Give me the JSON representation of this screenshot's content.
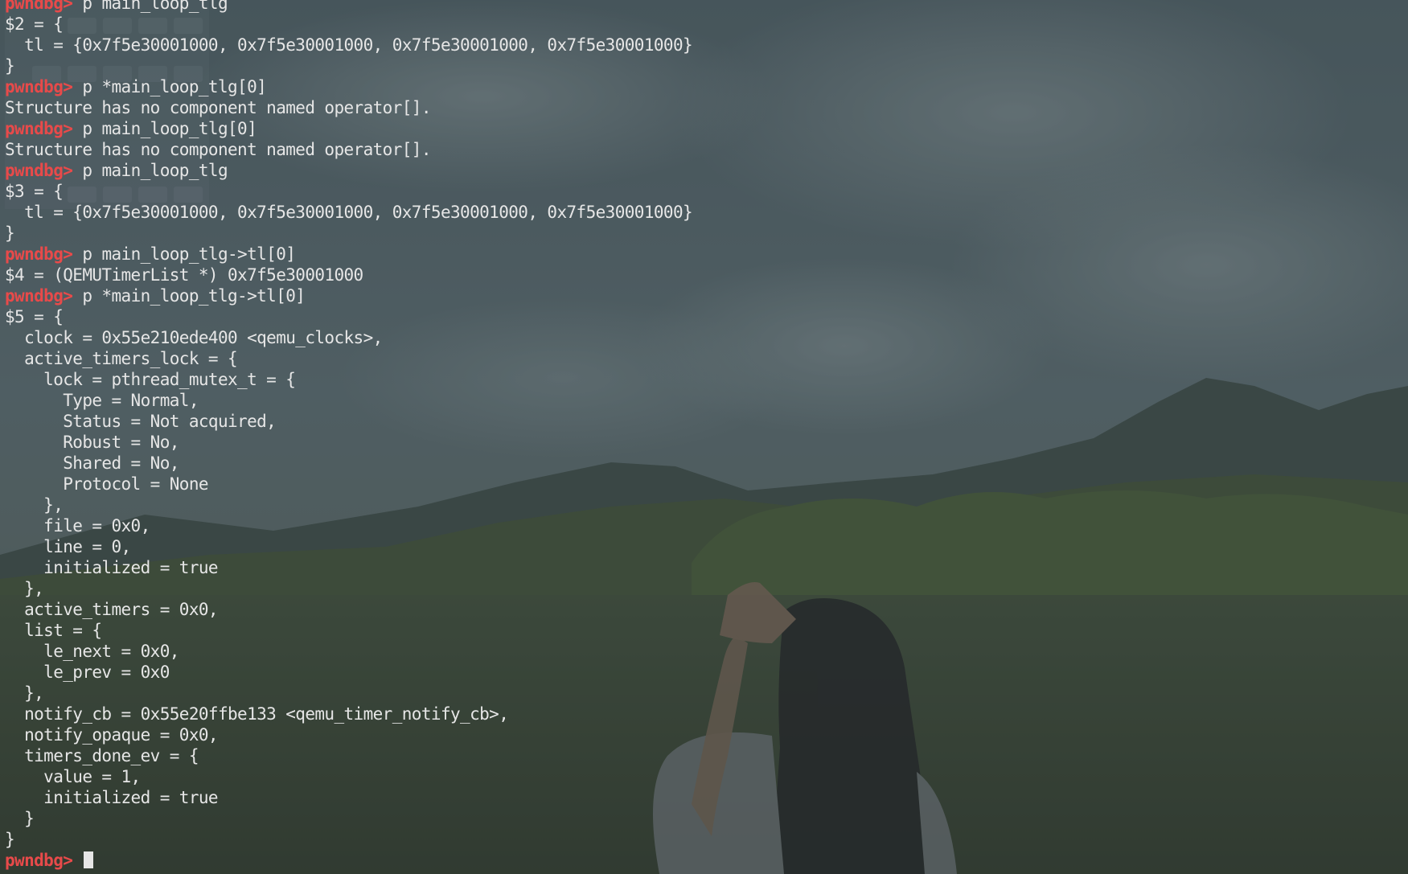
{
  "terminal": {
    "prompt": "pwndbg>",
    "lines": [
      {
        "type": "cmd",
        "text": "p main_loop_tlg"
      },
      {
        "type": "out",
        "text": "$2 = {"
      },
      {
        "type": "out",
        "text": "  tl = {0x7f5e30001000, 0x7f5e30001000, 0x7f5e30001000, 0x7f5e30001000}"
      },
      {
        "type": "out",
        "text": "}"
      },
      {
        "type": "cmd",
        "text": "p *main_loop_tlg[0]"
      },
      {
        "type": "out",
        "text": "Structure has no component named operator[]."
      },
      {
        "type": "cmd",
        "text": "p main_loop_tlg[0]"
      },
      {
        "type": "out",
        "text": "Structure has no component named operator[]."
      },
      {
        "type": "cmd",
        "text": "p main_loop_tlg"
      },
      {
        "type": "out",
        "text": "$3 = {"
      },
      {
        "type": "out",
        "text": "  tl = {0x7f5e30001000, 0x7f5e30001000, 0x7f5e30001000, 0x7f5e30001000}"
      },
      {
        "type": "out",
        "text": "}"
      },
      {
        "type": "cmd",
        "text": "p main_loop_tlg->tl[0]"
      },
      {
        "type": "out",
        "text": "$4 = (QEMUTimerList *) 0x7f5e30001000"
      },
      {
        "type": "cmd",
        "text": "p *main_loop_tlg->tl[0]"
      },
      {
        "type": "out",
        "text": "$5 = {"
      },
      {
        "type": "out",
        "text": "  clock = 0x55e210ede400 <qemu_clocks>,"
      },
      {
        "type": "out",
        "text": "  active_timers_lock = {"
      },
      {
        "type": "out",
        "text": "    lock = pthread_mutex_t = {"
      },
      {
        "type": "out",
        "text": "      Type = Normal,"
      },
      {
        "type": "out",
        "text": "      Status = Not acquired,"
      },
      {
        "type": "out",
        "text": "      Robust = No,"
      },
      {
        "type": "out",
        "text": "      Shared = No,"
      },
      {
        "type": "out",
        "text": "      Protocol = None"
      },
      {
        "type": "out",
        "text": "    },"
      },
      {
        "type": "out",
        "text": "    file = 0x0,"
      },
      {
        "type": "out",
        "text": "    line = 0,"
      },
      {
        "type": "out",
        "text": "    initialized = true"
      },
      {
        "type": "out",
        "text": "  },"
      },
      {
        "type": "out",
        "text": "  active_timers = 0x0,"
      },
      {
        "type": "out",
        "text": "  list = {"
      },
      {
        "type": "out",
        "text": "    le_next = 0x0,"
      },
      {
        "type": "out",
        "text": "    le_prev = 0x0"
      },
      {
        "type": "out",
        "text": "  },"
      },
      {
        "type": "out",
        "text": "  notify_cb = 0x55e20ffbe133 <qemu_timer_notify_cb>,"
      },
      {
        "type": "out",
        "text": "  notify_opaque = 0x0,"
      },
      {
        "type": "out",
        "text": "  timers_done_ev = {"
      },
      {
        "type": "out",
        "text": "    value = 1,"
      },
      {
        "type": "out",
        "text": "    initialized = true"
      },
      {
        "type": "out",
        "text": "  }"
      },
      {
        "type": "out",
        "text": "}"
      },
      {
        "type": "prompt_active",
        "text": ""
      }
    ]
  },
  "colors": {
    "prompt": "#e84a4a",
    "text": "#e6e6e6",
    "cursor": "#e6e6e6"
  }
}
